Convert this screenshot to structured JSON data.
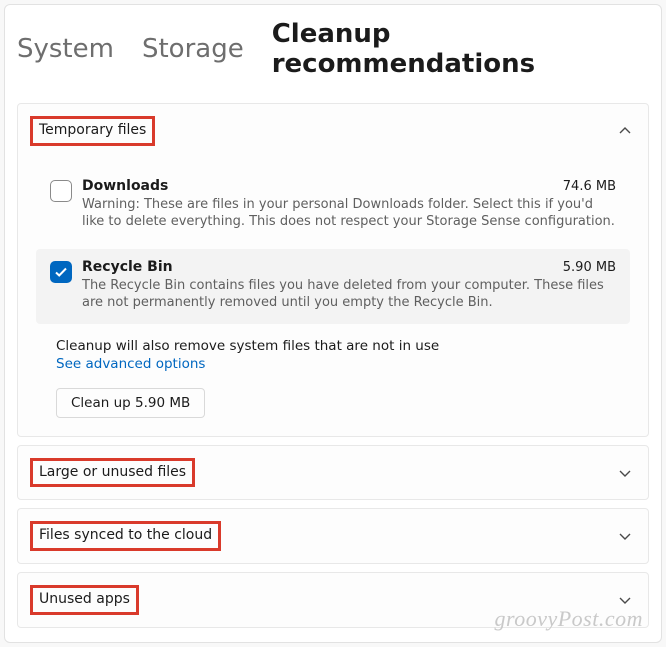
{
  "breadcrumb": {
    "system": "System",
    "storage": "Storage",
    "current": "Cleanup recommendations"
  },
  "sections": {
    "temporary": {
      "title": "Temporary files",
      "downloads": {
        "title": "Downloads",
        "size": "74.6 MB",
        "desc": "Warning: These are files in your personal Downloads folder. Select this if you'd like to delete everything. This does not respect your Storage Sense configuration."
      },
      "recycle": {
        "title": "Recycle Bin",
        "size": "5.90 MB",
        "desc": "The Recycle Bin contains files you have deleted from your computer. These files are not permanently removed until you empty the Recycle Bin."
      },
      "note": "Cleanup will also remove system files that are not in use",
      "advanced_link": "See advanced options",
      "cleanup_button": "Clean up 5.90 MB"
    },
    "large": {
      "title": "Large or unused files"
    },
    "cloud": {
      "title": "Files synced to the cloud"
    },
    "unused_apps": {
      "title": "Unused apps"
    }
  },
  "watermark": "groovyPost.com"
}
